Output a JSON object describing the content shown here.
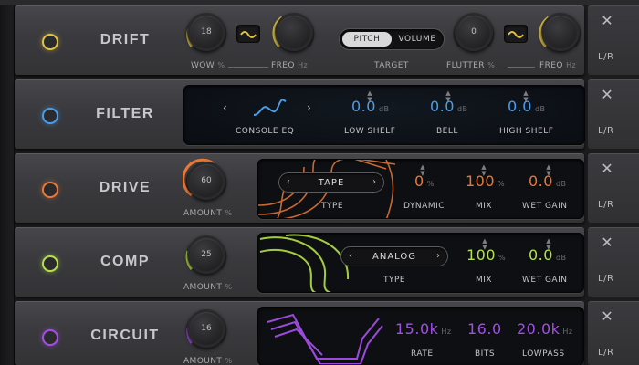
{
  "colors": {
    "drift": "#e0c340",
    "filter": "#4a9de8",
    "drive": "#e8793a",
    "comp": "#b6e04a",
    "circuit": "#a44ee8"
  },
  "common": {
    "close_icon": "close-icon",
    "lr_label": "L/R"
  },
  "drift": {
    "name": "DRIFT",
    "wow": {
      "value": "18",
      "label": "WOW",
      "unit": "%"
    },
    "freq1": {
      "label": "FREQ",
      "unit": "Hz"
    },
    "toggle": {
      "left": "PITCH",
      "right": "VOLUME",
      "selected": "PITCH"
    },
    "target_label": "TARGET",
    "flutter": {
      "value": "0",
      "label": "FLUTTER",
      "unit": "%"
    },
    "freq2": {
      "label": "FREQ",
      "unit": "Hz"
    }
  },
  "filter": {
    "name": "FILTER",
    "preset": {
      "value": "CONSOLE EQ",
      "prev": "‹",
      "next": "›"
    },
    "params": [
      {
        "label": "LOW SHELF",
        "value": "0.0",
        "unit": "dB"
      },
      {
        "label": "BELL",
        "value": "0.0",
        "unit": "dB"
      },
      {
        "label": "HIGH SHELF",
        "value": "0.0",
        "unit": "dB"
      }
    ]
  },
  "drive": {
    "name": "DRIVE",
    "amount": {
      "value": "60",
      "label": "AMOUNT",
      "unit": "%"
    },
    "type": {
      "value": "TAPE",
      "label": "TYPE",
      "prev": "‹",
      "next": "›"
    },
    "params": [
      {
        "label": "DYNAMIC",
        "value": "0",
        "unit": "%"
      },
      {
        "label": "MIX",
        "value": "100",
        "unit": "%"
      },
      {
        "label": "WET GAIN",
        "value": "0.0",
        "unit": "dB"
      }
    ]
  },
  "comp": {
    "name": "COMP",
    "amount": {
      "value": "25",
      "label": "AMOUNT",
      "unit": "%"
    },
    "type": {
      "value": "ANALOG",
      "label": "TYPE",
      "prev": "‹",
      "next": "›"
    },
    "params": [
      {
        "label": "MIX",
        "value": "100",
        "unit": "%"
      },
      {
        "label": "WET GAIN",
        "value": "0.0",
        "unit": "dB"
      }
    ]
  },
  "circuit": {
    "name": "CIRCUIT",
    "amount": {
      "value": "16",
      "label": "AMOUNT",
      "unit": "%"
    },
    "params": [
      {
        "label": "RATE",
        "value": "15.0k",
        "unit": "Hz"
      },
      {
        "label": "BITS",
        "value": "16.0",
        "unit": ""
      },
      {
        "label": "LOWPASS",
        "value": "20.0k",
        "unit": "Hz"
      }
    ]
  }
}
